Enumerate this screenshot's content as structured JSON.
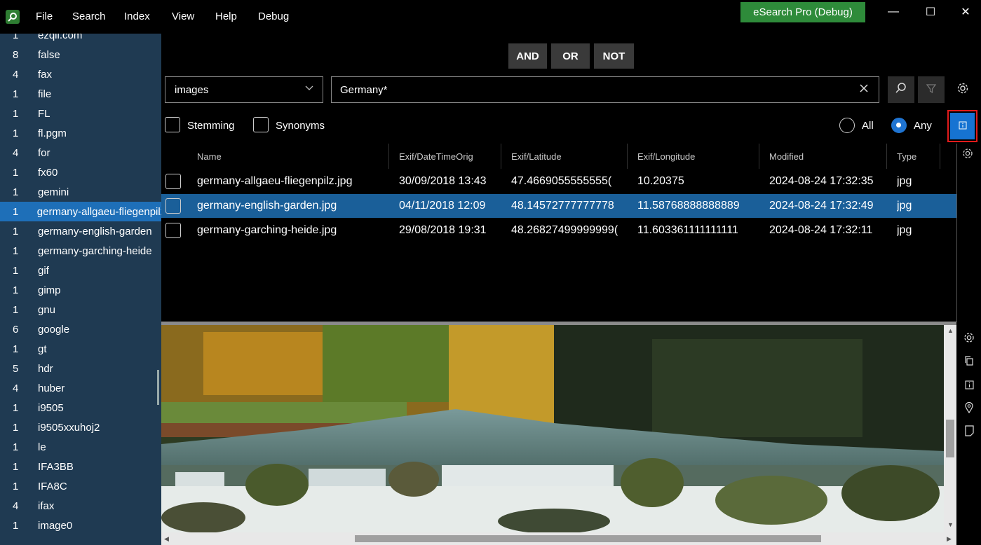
{
  "menu": [
    "File",
    "Search",
    "Index",
    "View",
    "Help",
    "Debug"
  ],
  "title_badge": "eSearch Pro (Debug)",
  "window_controls": {
    "minimize": "—",
    "maximize": "☐",
    "close": "✕"
  },
  "sidebar": {
    "terms": [
      {
        "count": "1",
        "label": "ezqli.com"
      },
      {
        "count": "8",
        "label": "false"
      },
      {
        "count": "4",
        "label": "fax"
      },
      {
        "count": "1",
        "label": "file"
      },
      {
        "count": "1",
        "label": "FL"
      },
      {
        "count": "1",
        "label": "fl.pgm"
      },
      {
        "count": "4",
        "label": "for"
      },
      {
        "count": "1",
        "label": "fx60"
      },
      {
        "count": "1",
        "label": "gemini"
      },
      {
        "count": "1",
        "label": "germany-allgaeu-fliegenpilz"
      },
      {
        "count": "1",
        "label": "germany-english-garden"
      },
      {
        "count": "1",
        "label": "germany-garching-heide"
      },
      {
        "count": "1",
        "label": "gif"
      },
      {
        "count": "1",
        "label": "gimp"
      },
      {
        "count": "1",
        "label": "gnu"
      },
      {
        "count": "6",
        "label": "google"
      },
      {
        "count": "1",
        "label": "gt"
      },
      {
        "count": "5",
        "label": "hdr"
      },
      {
        "count": "4",
        "label": "huber"
      },
      {
        "count": "1",
        "label": "i9505"
      },
      {
        "count": "1",
        "label": "i9505xxuhoj2"
      },
      {
        "count": "1",
        "label": "le"
      },
      {
        "count": "1",
        "label": "IFA3BB"
      },
      {
        "count": "1",
        "label": "IFA8C"
      },
      {
        "count": "4",
        "label": "ifax"
      },
      {
        "count": "1",
        "label": "image0"
      }
    ],
    "selected_index": 9
  },
  "boolean_ops": {
    "and": "AND",
    "or": "OR",
    "not": "NOT"
  },
  "search": {
    "index_value": "images",
    "query": "Germany*",
    "clear_icon": "close-icon",
    "search_icon": "search-icon",
    "filter_icon": "filter-icon",
    "settings_icon": "gear-icon"
  },
  "options": {
    "stemming": {
      "label": "Stemming",
      "checked": false
    },
    "synonyms": {
      "label": "Synonyms",
      "checked": false
    },
    "match_all": {
      "label": "All",
      "selected": false
    },
    "match_any": {
      "label": "Any",
      "selected": true
    },
    "info_icon": "info-icon"
  },
  "results": {
    "columns": [
      "Name",
      "Exif/DateTimeOrig",
      "Exif/Latitude",
      "Exif/Longitude",
      "Modified",
      "Type"
    ],
    "rows": [
      {
        "name": "germany-allgaeu-fliegenpilz.jpg",
        "date": "30/09/2018 13:43",
        "lat": "47.4669055555555(",
        "lon": "10.20375",
        "modified": "2024-08-24 17:32:35",
        "type": "jpg"
      },
      {
        "name": "germany-english-garden.jpg",
        "date": "04/11/2018 12:09",
        "lat": "48.14572777777778",
        "lon": "11.58768888888889",
        "modified": "2024-08-24 17:32:49",
        "type": "jpg"
      },
      {
        "name": "germany-garching-heide.jpg",
        "date": "29/08/2018 19:31",
        "lat": "48.26827499999999(",
        "lon": "11.603361111111111",
        "modified": "2024-08-24 17:32:11",
        "type": "jpg"
      }
    ],
    "selected_index": 1
  },
  "preview": {
    "side_icons": [
      "gear-icon",
      "copy-icon",
      "info-icon",
      "location-pin-icon",
      "document-icon"
    ],
    "image_subject": "waterfall in English Garden with autumn trees"
  },
  "colors": {
    "sidebar_bg": "#1f3a52",
    "selection": "#1a5f99",
    "accent": "#1f74d2",
    "badge": "#2e8b3a",
    "highlight_border": "#e21b1b"
  }
}
